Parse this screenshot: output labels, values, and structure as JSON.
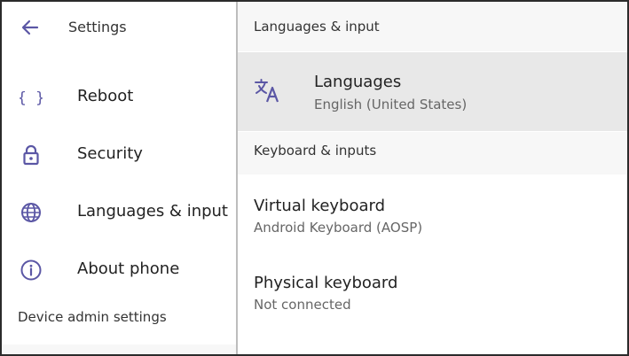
{
  "accent_color": "#5b57a5",
  "header": {
    "title": "Settings",
    "back_icon": "arrow-left-icon"
  },
  "sidebar": {
    "items": [
      {
        "label": "Reboot",
        "icon": "braces-icon"
      },
      {
        "label": "Security",
        "icon": "lock-icon"
      },
      {
        "label": "Languages & input",
        "icon": "globe-icon"
      },
      {
        "label": "About phone",
        "icon": "info-icon"
      }
    ],
    "footer": "Device admin settings"
  },
  "main": {
    "title": "Languages & input",
    "languages": {
      "title": "Languages",
      "subtitle": "English (United States)",
      "icon": "translate-icon"
    },
    "section": "Keyboard & inputs",
    "keyboards": [
      {
        "title": "Virtual keyboard",
        "subtitle": "Android Keyboard (AOSP)"
      },
      {
        "title": "Physical keyboard",
        "subtitle": "Not connected"
      }
    ]
  }
}
